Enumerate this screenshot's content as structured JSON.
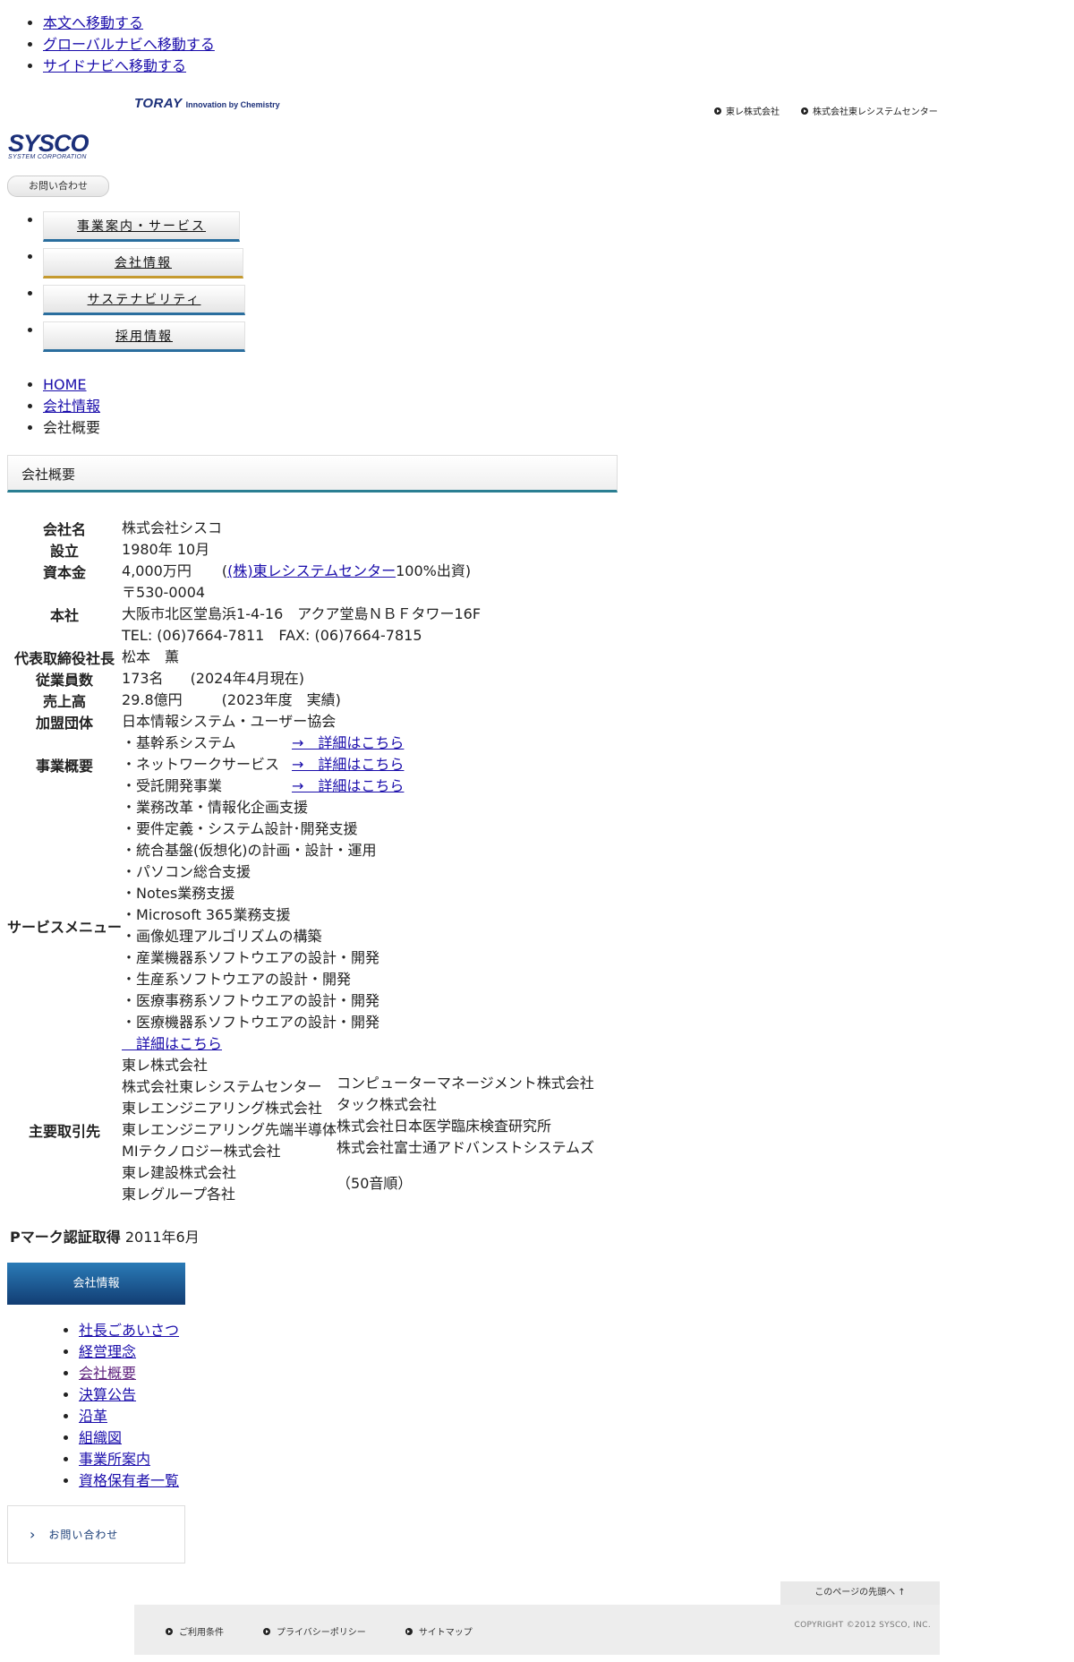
{
  "skip_links": [
    "本文へ移動する",
    "グローバルナビへ移動する",
    "サイドナビへ移動する"
  ],
  "toray": {
    "word": "TORAY",
    "tagline": "Innovation by Chemistry"
  },
  "header_links": [
    "東レ株式会社",
    "株式会社東レシステムセンター"
  ],
  "sysco": {
    "main": "SYSCO",
    "sub": "SYSTEM CORPORATION"
  },
  "contact_pill": "お問い合わせ",
  "gnav": [
    "事業案内・サービス",
    "会社情報",
    "サステナビリティ",
    "採用情報"
  ],
  "breadcrumb": [
    "HOME",
    "会社情報",
    "会社概要"
  ],
  "page_title": "会社概要",
  "profile": {
    "company_label": "会社名",
    "company": "株式会社シスコ",
    "founded_label": "設立",
    "founded": "1980年 10月",
    "capital_label": "資本金",
    "capital_amount": "4,000万円",
    "capital_paren_open": "(",
    "capital_link": "(株)東レシステムセンター",
    "capital_note": "100%出資)",
    "hq_label": "本社",
    "hq_postal": "〒530-0004",
    "hq_address": "大阪市北区堂島浜1-4-16　アクア堂島ＮＢＦタワー16F",
    "hq_tel": "TEL: (06)7664-7811　FAX: (06)7664-7815",
    "ceo_label": "代表取締役社長",
    "ceo": "松本　薫",
    "employees_label": "従業員数",
    "employees": "173名",
    "employees_note": "(2024年4月現在)",
    "sales_label": "売上高",
    "sales": "29.8億円",
    "sales_note": "(2023年度　実績)",
    "org_label": "加盟団体",
    "org": "日本情報システム・ユーザー協会",
    "business_label": "事業概要",
    "business": [
      {
        "name": "・基幹系システム",
        "link": "→　詳細はこちら"
      },
      {
        "name": "・ネットワークサービス",
        "link": "→　詳細はこちら"
      },
      {
        "name": "・受託開発事業",
        "link": "→　詳細はこちら"
      }
    ],
    "service_label": "サービスメニュー",
    "services": [
      "・業務改革・情報化企画支援",
      "・要件定義・システム設計･開発支援",
      "・統合基盤(仮想化)の計画・設計・運用",
      "・パソコン総合支援",
      "・Notes業務支援",
      "・Microsoft 365業務支援",
      "・画像処理アルゴリズムの構築",
      "・産業機器系ソフトウエアの設計・開発",
      "・生産系ソフトウエアの設計・開発",
      "・医療事務系ソフトウエアの設計・開発",
      "・医療機器系ソフトウエアの設計・開発"
    ],
    "service_link": "　詳細はこちら",
    "clients_label": "主要取引先",
    "clients_col1": [
      "東レ株式会社",
      "株式会社東レシステムセンター",
      "東レエンジニアリング株式会社",
      "東レエンジニアリング先端半導体",
      "MIテクノロジー株式会社",
      "東レ建設株式会社",
      "東レグループ各社"
    ],
    "clients_col2": [
      "コンピューターマネージメント株式会社",
      "タック株式会社",
      "株式会社日本医学臨床検査研究所",
      "株式会社富士通アドバンストシステムズ"
    ],
    "clients_note": "（50音順）"
  },
  "pmark": {
    "label": "Pマーク認証取得",
    "value": "2011年6月"
  },
  "side": {
    "title": "会社情報",
    "items": [
      "社長ごあいさつ",
      "経営理念",
      "会社概要",
      "決算公告",
      "沿革",
      "組織図",
      "事業所案内",
      "資格保有者一覧"
    ],
    "contact": "お問い合わせ"
  },
  "pagetop": "このページの先頭へ ↑",
  "footer": {
    "links": [
      "ご利用条件",
      "プライバシーポリシー",
      "サイトマップ"
    ],
    "copyright": "COPYRIGHT ©2012 SYSCO, INC."
  },
  "colors": {
    "accent_blue": "#1b2f79",
    "nav_underline_blue": "#2a6e9e",
    "nav_underline_gold": "#c59a2f",
    "side_title": "#123d73"
  }
}
